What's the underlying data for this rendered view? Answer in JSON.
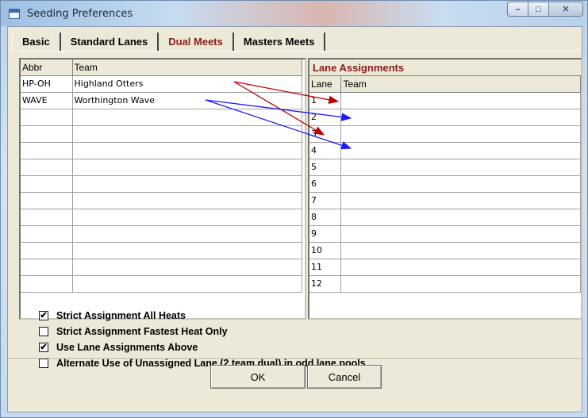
{
  "window": {
    "title": "Seeding Preferences",
    "controls": [
      "minimize",
      "maximize",
      "close"
    ]
  },
  "tabs": [
    {
      "label": "Basic",
      "active": false
    },
    {
      "label": "Standard Lanes",
      "active": false
    },
    {
      "label": "Dual Meets",
      "active": true
    },
    {
      "label": "Masters Meets",
      "active": false
    }
  ],
  "teams_table": {
    "columns": [
      "Abbr",
      "Team"
    ],
    "rows": [
      {
        "abbr": "HP-OH",
        "team": "Highland Otters"
      },
      {
        "abbr": "WAVE",
        "team": "Worthington Wave"
      }
    ],
    "empty_rows": 11
  },
  "lane_table": {
    "title": "Lane Assignments",
    "columns": [
      "Lane",
      "Team"
    ],
    "lanes": [
      "1",
      "2",
      "3",
      "4",
      "5",
      "6",
      "7",
      "8",
      "9",
      "10",
      "11",
      "12"
    ]
  },
  "options": [
    {
      "label": "Strict Assignment All Heats",
      "checked": true
    },
    {
      "label": "Strict Assignment Fastest Heat Only",
      "checked": false
    },
    {
      "label": "Use Lane Assignments Above",
      "checked": true
    },
    {
      "label": "Alternate Use of Unassigned Lane (2 team dual) in odd lane pools",
      "checked": false
    }
  ],
  "buttons": {
    "ok": "OK",
    "cancel": "Cancel"
  },
  "annotation_colors": {
    "red": "#c00000",
    "blue": "#1a1aff"
  }
}
